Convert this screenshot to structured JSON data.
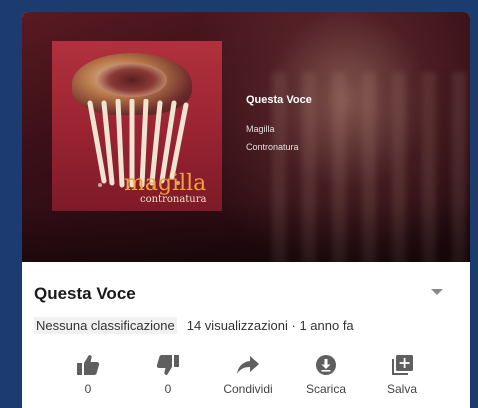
{
  "player": {
    "song_title": "Questa Voce",
    "artist": "Magilla",
    "album": "Contronatura",
    "cover_title": "magilla",
    "cover_subtitle": "contronatura"
  },
  "video": {
    "title": "Questa Voce",
    "rating": "Nessuna classificazione",
    "stats": "14 visualizzazioni · 1 anno fa"
  },
  "actions": [
    {
      "icon": "thumbs-up-icon",
      "label": "0"
    },
    {
      "icon": "thumbs-down-icon",
      "label": "0"
    },
    {
      "icon": "share-icon",
      "label": "Condividi"
    },
    {
      "icon": "download-icon",
      "label": "Scarica"
    },
    {
      "icon": "add-to-playlist-icon",
      "label": "Salva"
    }
  ],
  "colors": {
    "frame": "#1c3c70",
    "icon": "#5f5f5f",
    "cover_text": "#f2a23c"
  }
}
